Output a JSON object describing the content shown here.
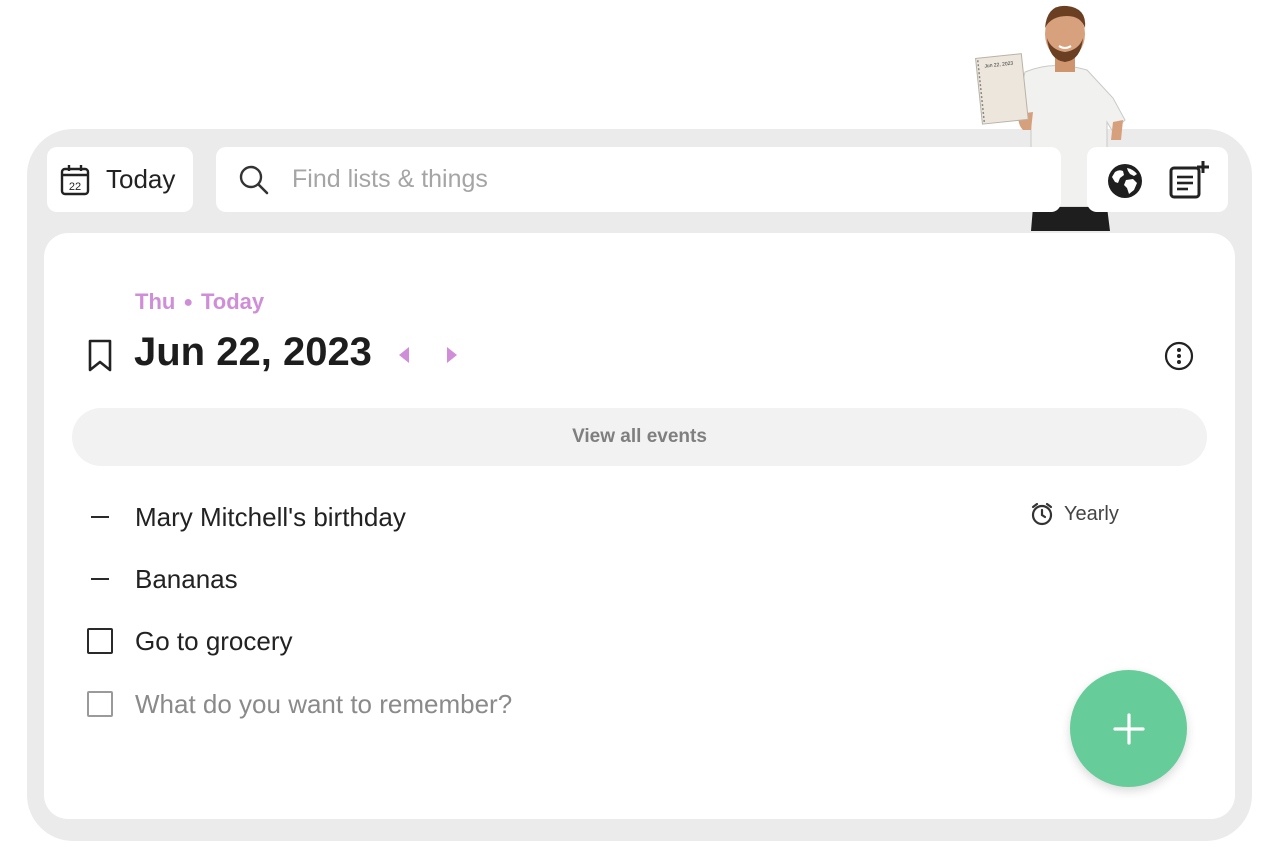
{
  "toolbar": {
    "today_label": "Today",
    "calendar_day": "22",
    "search_placeholder": "Find lists & things"
  },
  "person_sign": "Jun 22, 2023",
  "day_header": {
    "weekday": "Thu",
    "relative": "Today",
    "date": "Jun 22, 2023"
  },
  "view_all_label": "View all events",
  "items": [
    {
      "kind": "event",
      "text": "Mary Mitchell's birthday",
      "repeat": "Yearly"
    },
    {
      "kind": "note",
      "text": "Bananas"
    },
    {
      "kind": "task",
      "text": "Go to grocery",
      "checked": false
    }
  ],
  "new_item_placeholder": "What do you want to remember?",
  "colors": {
    "accent": "#cf8ed7",
    "fab": "#66cc99",
    "frame": "#ebebeb"
  },
  "icons": [
    "calendar-icon",
    "search-icon",
    "globe-icon",
    "new-note-icon",
    "bookmark-icon",
    "arrow-left-icon",
    "arrow-right-icon",
    "more-icon",
    "alarm-icon",
    "plus-icon"
  ]
}
